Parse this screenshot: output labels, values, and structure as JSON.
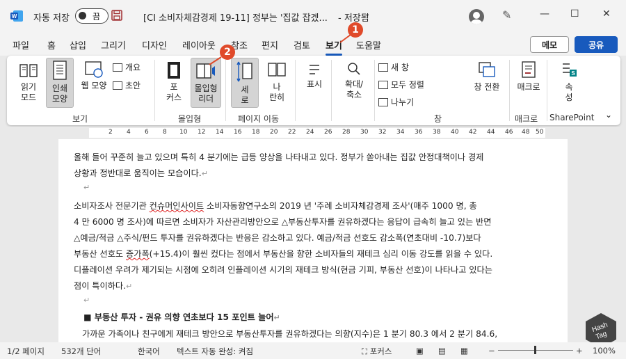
{
  "titlebar": {
    "autosave_label": "자동 저장",
    "toggle_state": "끔",
    "document_title": "[CI 소비자체감경제 19-11] 정부는 '집값 잡겠...",
    "saved_state": "- 저장됨",
    "saved_caret": "⌄",
    "minimize": "—",
    "maximize": "☐",
    "close": "✕"
  },
  "tabs": [
    "파일",
    "홈",
    "삽입",
    "그리기",
    "디자인",
    "레이아웃",
    "참조",
    "편지",
    "검토",
    "보기",
    "도움말"
  ],
  "active_tab": "보기",
  "buttons": {
    "memo": "메모",
    "share": "공유"
  },
  "ribbon": {
    "read_mode": [
      "읽기",
      "모드"
    ],
    "print_layout": [
      "인쇄",
      "모양"
    ],
    "web_layout": "웹 모양",
    "outline": "개요",
    "draft": "초안",
    "focus": [
      "포",
      "커스"
    ],
    "immersive_reader": [
      "몰입형",
      "리더"
    ],
    "vertical": [
      "세",
      "로"
    ],
    "side_by_side": [
      "나",
      "란히"
    ],
    "show": "표시",
    "zoom": [
      "확대/",
      "축소"
    ],
    "new_window": "새 창",
    "arrange_all": "모두 정렬",
    "split": "나누기",
    "switch_windows": [
      "창 전환"
    ],
    "macros": [
      "매크로"
    ],
    "properties": [
      "속",
      "성"
    ],
    "groups": {
      "views": "보기",
      "immersive": "몰입형",
      "page_movement": "페이지 이동",
      "window": "창",
      "macros": "매크로",
      "sharepoint": "SharePoint"
    }
  },
  "badges": [
    "1",
    "2"
  ],
  "ruler_ticks": [
    "2",
    "4",
    "6",
    "8",
    "10",
    "12",
    "14",
    "16",
    "18",
    "20",
    "22",
    "24",
    "26",
    "28",
    "30",
    "32",
    "34",
    "36",
    "38",
    "40",
    "42",
    "44",
    "46",
    "48",
    "50"
  ],
  "document": {
    "l1": "올해 들어 꾸준히 늘고 있으며 특히 4 분기에는 급등 양상을 나타내고 있다. 정부가 쏟아내는 집값 안정대책이나 경제",
    "l2": "상황과 정반대로 움직이는 모습이다.",
    "p2_1a": "  소비자조사 전문기관 ",
    "p2_1b": "컨슈머인사이트",
    "p2_1c": " 소비자동향연구소의 2019 년 '주례 소비자체감경제 조사'(매주 1000 명, 총",
    "p2_2": "4 만 6000 명 조사)에 따르면 소비자가 자산관리방안으로 △부동산투자를 권유하겠다는 응답이 급속히 늘고 있는 반면",
    "p2_3": "△예금/적금 △주식/펀드 투자를 권유하겠다는 반응은 감소하고 있다. 예금/적금 선호도 감소폭(연초대비 -10.7)보다",
    "p2_4a": "부동산 선호도 ",
    "p2_4b": "증가폭",
    "p2_4c": "(+15.4)이 훨씬 컸다는 점에서 부동산을 향한 소비자들의 재테크 심리 이동 강도를 읽을 수 있다.",
    "p2_5": "디플레이션 우려가 제기되는 시점에 오히려 인플레이션 시기의 재테크 방식(현금 기피, 부동산 선호)이 나타나고 있다는",
    "p2_6": "점이 특이하다.",
    "heading": "■ 부동산 투자 - 권유 의향 연초보다 15 포인트 늘어",
    "p3_1": "가까운 가족이나 친구에게 재테크 방안으로 부동산투자를 권유하겠다는 의향(지수)은 1 분기 80.3 에서 2 분기 84.6,",
    "para_mark": "↵",
    "enter_mark": "↵"
  },
  "status": {
    "page": "1/2 페이지",
    "words": "532개 단어",
    "language": "한국어",
    "autocomplete": "텍스트 자동 완성: 켜짐",
    "focus": "포커스",
    "zoom": "100%"
  },
  "watermark": [
    "Hash",
    "Tag"
  ],
  "colors": {
    "accent": "#185abd",
    "badge": "#e04a2a",
    "word_blue": "#185abd",
    "save_purple": "#a4373a"
  }
}
